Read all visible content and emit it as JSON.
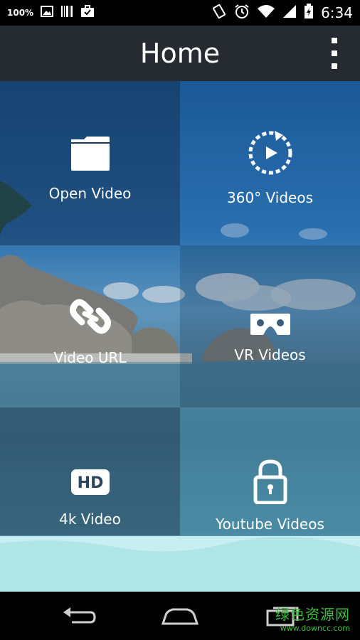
{
  "status_bar": {
    "battery_text": "100%",
    "time": "6:34",
    "icons": [
      "image-icon",
      "barcode-icon",
      "briefcase-icon",
      "rotate-icon",
      "alarm-icon",
      "wifi-icon",
      "signal-icon",
      "battery-icon"
    ]
  },
  "app_bar": {
    "title": "Home",
    "menu_icon": "overflow-menu-icon"
  },
  "tiles": [
    {
      "label": "Open Video",
      "icon": "folder-icon"
    },
    {
      "label": "360° Videos",
      "icon": "360-play-icon"
    },
    {
      "label": "Video URL",
      "icon": "link-icon"
    },
    {
      "label": "VR Videos",
      "icon": "vr-headset-icon"
    },
    {
      "label": "4k Video",
      "icon": "hd-icon"
    },
    {
      "label": "Youtube Videos",
      "icon": "lock-icon"
    }
  ],
  "nav_bar": {
    "icons": [
      "back-icon",
      "home-icon",
      "recents-icon"
    ]
  },
  "watermark": {
    "text": "绿色资源网",
    "url": "www.downcc.com"
  },
  "colors": {
    "app_bar": "#262b31",
    "status_bar": "#000000",
    "watermark": "#3cbf3c"
  }
}
